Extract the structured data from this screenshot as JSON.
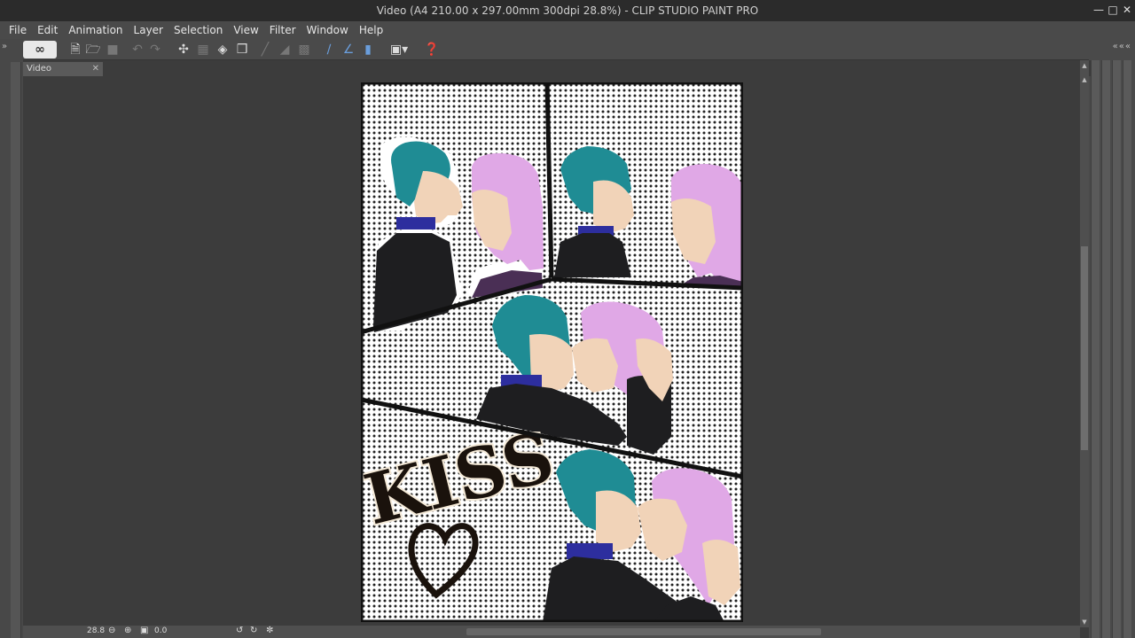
{
  "window": {
    "title": "Video (A4 210.00 x 297.00mm 300dpi 28.8%)  - CLIP STUDIO PAINT PRO",
    "controls": [
      "minimize-icon",
      "maximize-icon",
      "close-icon"
    ]
  },
  "menu": [
    "File",
    "Edit",
    "Animation",
    "Layer",
    "Selection",
    "View",
    "Filter",
    "Window",
    "Help"
  ],
  "toolbar": {
    "items": [
      "clip-studio-logo",
      "new-document-icon",
      "open-folder-icon",
      "save-icon",
      "undo-icon",
      "redo-icon",
      "transform-handles-icon",
      "clear-icon",
      "fill-icon",
      "scale-icon",
      "deselect-icon",
      "invert-selection-icon",
      "select-layer-icon",
      "ruler-snap-icon",
      "special-ruler-snap-icon",
      "grid-snap-icon",
      "screen-mode-icon",
      "help-icon"
    ]
  },
  "document_tab": {
    "label": "Video"
  },
  "statusbar": {
    "zoom": "28.8",
    "angle": "0.0"
  },
  "artwork": {
    "title_text": "KISS",
    "colors": {
      "hair_teal": "#1f8c94",
      "hair_pink": "#e0a8e6",
      "skin": "#f1d3b8",
      "jacket": "#1e1e20",
      "collar": "#2d2e9e",
      "panel_border": "#111111"
    }
  }
}
